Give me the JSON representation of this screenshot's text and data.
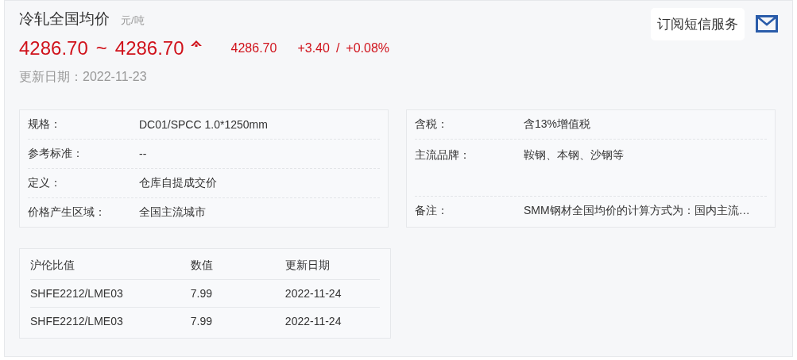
{
  "header": {
    "title": "冷轧全国均价",
    "unit": "元/吨",
    "price_low": "4286.70",
    "separator": "~",
    "price_high": "4286.70",
    "average": "4286.70",
    "change": "+3.40",
    "change_separator": "/",
    "change_percent": "+0.08%",
    "date_label": "更新日期：",
    "date": "2022-11-23"
  },
  "subscribe": {
    "tooltip": "订阅短信服务"
  },
  "specs_left": [
    {
      "label": "规格：",
      "value": "DC01/SPCC 1.0*1250mm"
    },
    {
      "label": "参考标准：",
      "value": "--"
    },
    {
      "label": "定义：",
      "value": "仓库自提成交价"
    },
    {
      "label": "价格产生区域：",
      "value": "全国主流城市"
    }
  ],
  "specs_right": [
    {
      "label": "含税：",
      "value": "含13%增值税",
      "kind": "single"
    },
    {
      "label": "主流品牌：",
      "value": "鞍钢、本钢、沙钢等",
      "kind": "double"
    },
    {
      "label": "备注：",
      "value": "SMM钢材全国均价的计算方式为：国内主流…",
      "kind": "single"
    }
  ],
  "table": {
    "columns": [
      "沪伦比值",
      "数值",
      "更新日期"
    ],
    "rows": [
      [
        "SHFE2212/LME03",
        "7.99",
        "2022-11-24"
      ],
      [
        "SHFE2212/LME03",
        "7.99",
        "2022-11-24"
      ]
    ]
  }
}
